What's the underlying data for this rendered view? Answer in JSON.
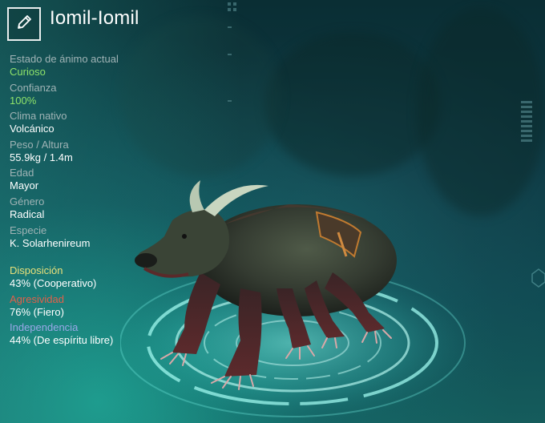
{
  "creature": {
    "name": "Iomil-Iomil",
    "edit_icon": "pencil-icon"
  },
  "stats": [
    {
      "label": "Estado de ánimo actual",
      "value": "Curioso",
      "value_color": "#8fe36a"
    },
    {
      "label": "Confianza",
      "value": "100%",
      "value_color": "#8fe36a"
    },
    {
      "label": "Clima nativo",
      "value": "Volcánico",
      "value_color": "#ffffff"
    },
    {
      "label": "Peso / Altura",
      "value": "55.9kg / 1.4m",
      "value_color": "#ffffff"
    },
    {
      "label": "Edad",
      "value": "Mayor",
      "value_color": "#ffffff"
    },
    {
      "label": "Género",
      "value": "Radical",
      "value_color": "#ffffff"
    },
    {
      "label": "Especie",
      "value": "K. Solarhenireum",
      "value_color": "#ffffff"
    }
  ],
  "traits": [
    {
      "label": "Disposición",
      "value": "43% (Cooperativo)",
      "color": "#e8e07a"
    },
    {
      "label": "Agresividad",
      "value": "76% (Fiero)",
      "color": "#e0604a"
    },
    {
      "label": "Independencia",
      "value": "44% (De espíritu libre)",
      "color": "#9aa8e8"
    }
  ]
}
